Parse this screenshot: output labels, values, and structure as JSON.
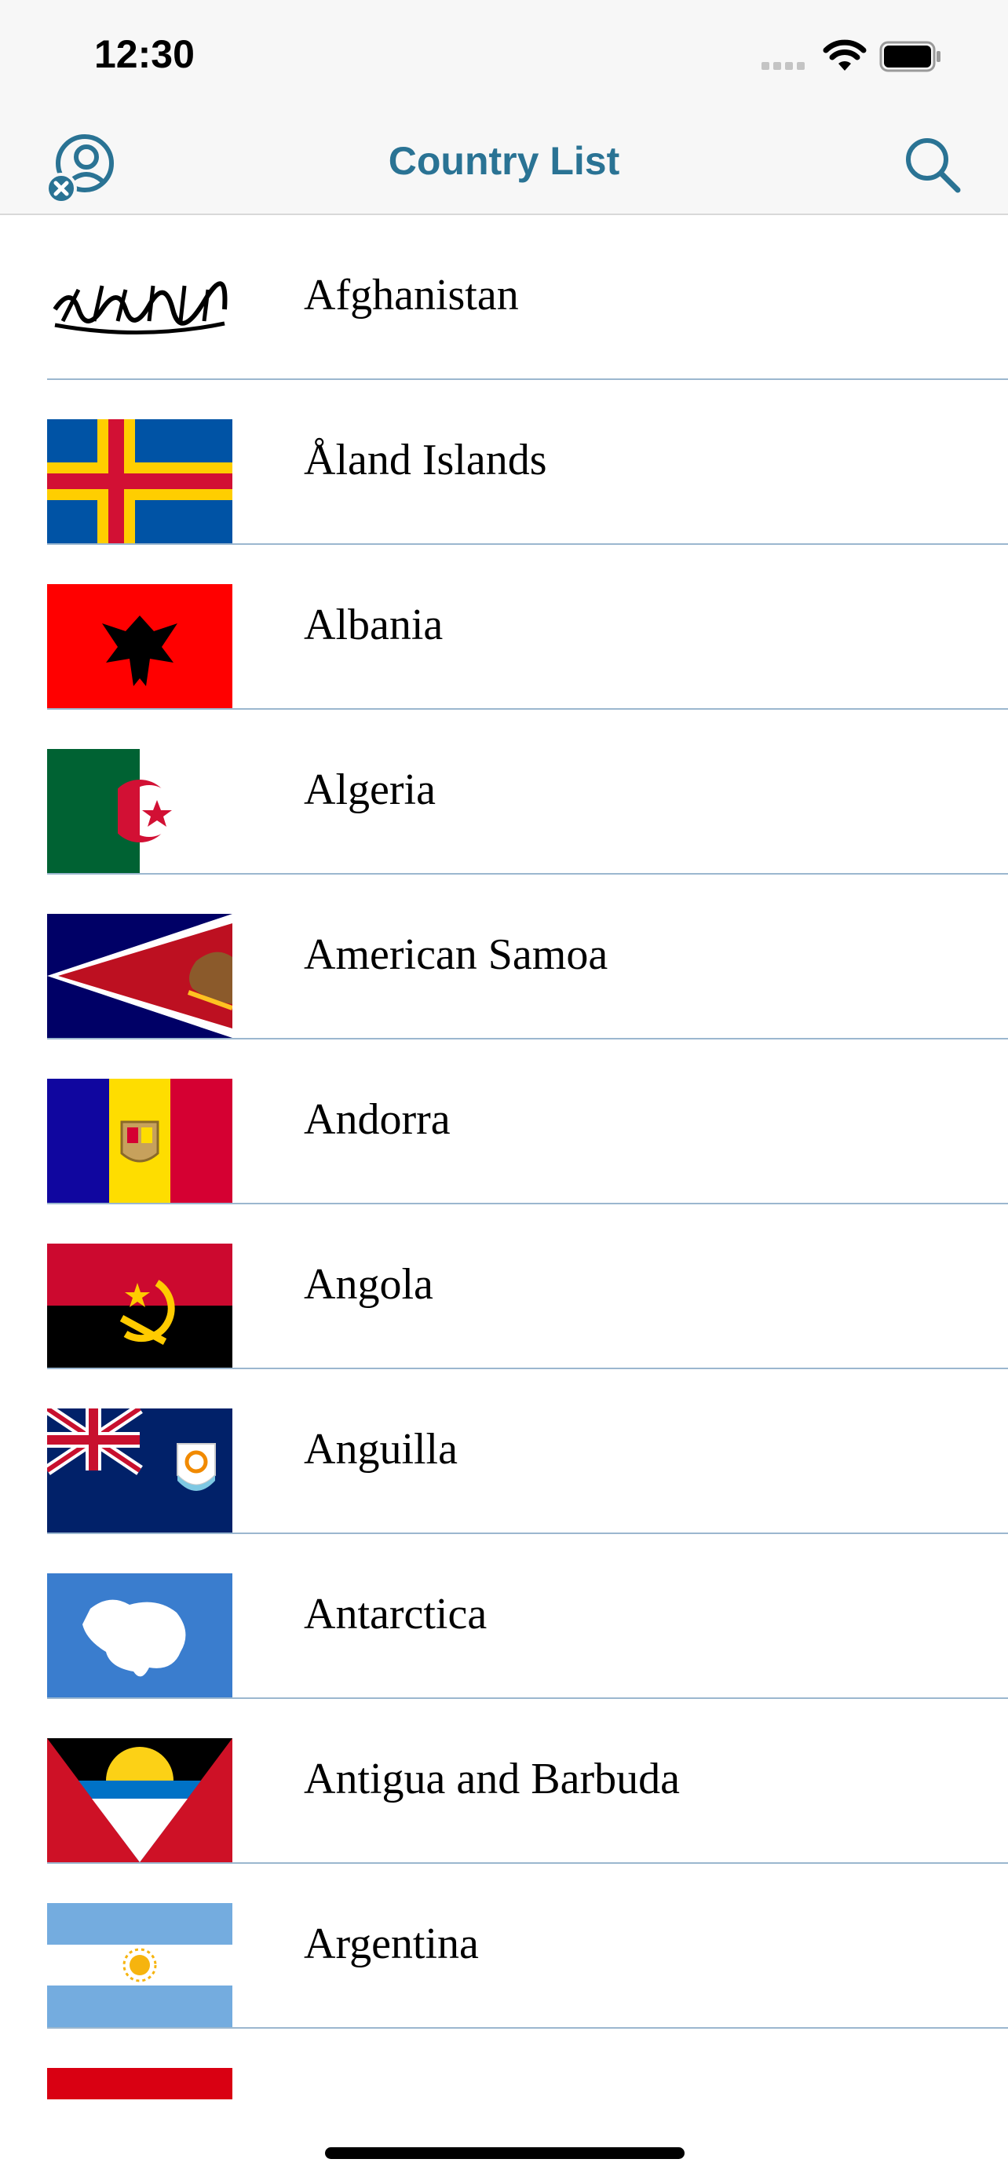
{
  "status_bar": {
    "time": "12:30"
  },
  "nav": {
    "title": "Country List",
    "left_icon": "profile-remove-icon",
    "right_icon": "search-icon"
  },
  "countries": [
    {
      "name": "Afghanistan"
    },
    {
      "name": "Åland Islands"
    },
    {
      "name": "Albania"
    },
    {
      "name": "Algeria"
    },
    {
      "name": "American Samoa"
    },
    {
      "name": "Andorra"
    },
    {
      "name": "Angola"
    },
    {
      "name": "Anguilla"
    },
    {
      "name": "Antarctica"
    },
    {
      "name": "Antigua and Barbuda"
    },
    {
      "name": "Argentina"
    },
    {
      "name": ""
    }
  ],
  "colors": {
    "accent": "#2a7394",
    "separator": "#9bb7cf",
    "bar_background": "#f7f7f7"
  }
}
